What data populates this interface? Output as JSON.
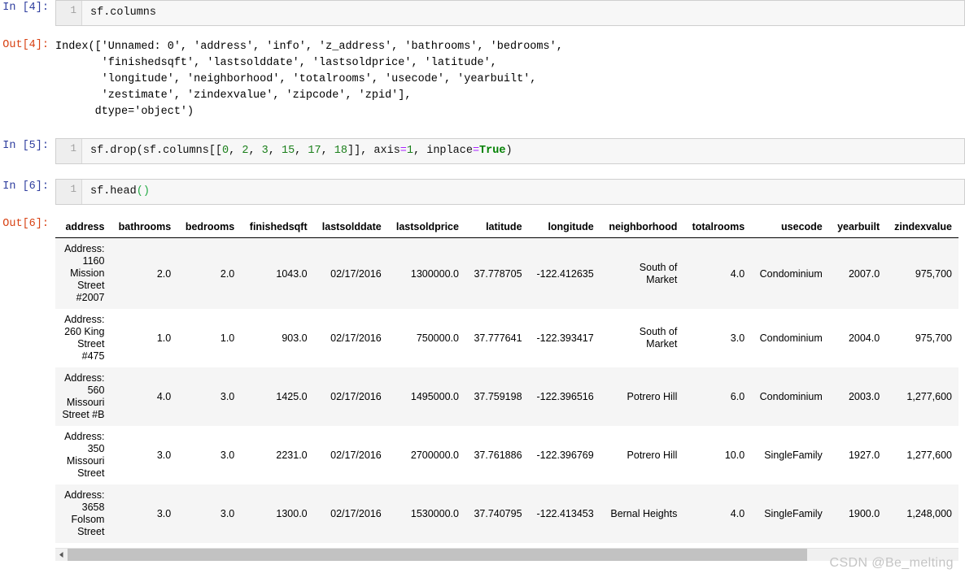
{
  "cells": [
    {
      "prompt_in": "In [4]:",
      "line_no": "1",
      "code": "sf.columns",
      "prompt_out": "Out[4]:",
      "output_text": "Index(['Unnamed: 0', 'address', 'info', 'z_address', 'bathrooms', 'bedrooms',\n       'finishedsqft', 'lastsolddate', 'lastsoldprice', 'latitude',\n       'longitude', 'neighborhood', 'totalrooms', 'usecode', 'yearbuilt',\n       'zestimate', 'zindexvalue', 'zipcode', 'zpid'],\n      dtype='object')"
    },
    {
      "prompt_in": "In [5]:",
      "line_no": "1",
      "code_parts": [
        {
          "text": "sf.drop(sf.columns[[",
          "type": "plain"
        },
        {
          "text": "0",
          "type": "num"
        },
        {
          "text": ", ",
          "type": "plain"
        },
        {
          "text": "2",
          "type": "num"
        },
        {
          "text": ", ",
          "type": "plain"
        },
        {
          "text": "3",
          "type": "num"
        },
        {
          "text": ", ",
          "type": "plain"
        },
        {
          "text": "15",
          "type": "num"
        },
        {
          "text": ", ",
          "type": "plain"
        },
        {
          "text": "17",
          "type": "num"
        },
        {
          "text": ", ",
          "type": "plain"
        },
        {
          "text": "18",
          "type": "num"
        },
        {
          "text": "]], axis",
          "type": "plain"
        },
        {
          "text": "=",
          "type": "op"
        },
        {
          "text": "1",
          "type": "num"
        },
        {
          "text": ", inplace",
          "type": "plain"
        },
        {
          "text": "=",
          "type": "op"
        },
        {
          "text": "True",
          "type": "kw"
        },
        {
          "text": ")",
          "type": "plain"
        }
      ]
    },
    {
      "prompt_in": "In [6]:",
      "line_no": "1",
      "code_head": "sf.head",
      "code_parens": "()",
      "prompt_out": "Out[6]:"
    }
  ],
  "dataframe": {
    "columns": [
      "address",
      "bathrooms",
      "bedrooms",
      "finishedsqft",
      "lastsolddate",
      "lastsoldprice",
      "latitude",
      "longitude",
      "neighborhood",
      "totalrooms",
      "usecode",
      "yearbuilt",
      "zindexvalue"
    ],
    "rows": [
      {
        "address": "Address: 1160 Mission Street #2007",
        "bathrooms": "2.0",
        "bedrooms": "2.0",
        "finishedsqft": "1043.0",
        "lastsolddate": "02/17/2016",
        "lastsoldprice": "1300000.0",
        "latitude": "37.778705",
        "longitude": "-122.412635",
        "neighborhood": "South of Market",
        "totalrooms": "4.0",
        "usecode": "Condominium",
        "yearbuilt": "2007.0",
        "zindexvalue": "975,700"
      },
      {
        "address": "Address: 260 King Street #475",
        "bathrooms": "1.0",
        "bedrooms": "1.0",
        "finishedsqft": "903.0",
        "lastsolddate": "02/17/2016",
        "lastsoldprice": "750000.0",
        "latitude": "37.777641",
        "longitude": "-122.393417",
        "neighborhood": "South of Market",
        "totalrooms": "3.0",
        "usecode": "Condominium",
        "yearbuilt": "2004.0",
        "zindexvalue": "975,700"
      },
      {
        "address": "Address: 560 Missouri Street #B",
        "bathrooms": "4.0",
        "bedrooms": "3.0",
        "finishedsqft": "1425.0",
        "lastsolddate": "02/17/2016",
        "lastsoldprice": "1495000.0",
        "latitude": "37.759198",
        "longitude": "-122.396516",
        "neighborhood": "Potrero Hill",
        "totalrooms": "6.0",
        "usecode": "Condominium",
        "yearbuilt": "2003.0",
        "zindexvalue": "1,277,600"
      },
      {
        "address": "Address: 350 Missouri Street",
        "bathrooms": "3.0",
        "bedrooms": "3.0",
        "finishedsqft": "2231.0",
        "lastsolddate": "02/17/2016",
        "lastsoldprice": "2700000.0",
        "latitude": "37.761886",
        "longitude": "-122.396769",
        "neighborhood": "Potrero Hill",
        "totalrooms": "10.0",
        "usecode": "SingleFamily",
        "yearbuilt": "1927.0",
        "zindexvalue": "1,277,600"
      },
      {
        "address": "Address: 3658 Folsom Street",
        "bathrooms": "3.0",
        "bedrooms": "3.0",
        "finishedsqft": "1300.0",
        "lastsolddate": "02/17/2016",
        "lastsoldprice": "1530000.0",
        "latitude": "37.740795",
        "longitude": "-122.413453",
        "neighborhood": "Bernal Heights",
        "totalrooms": "4.0",
        "usecode": "SingleFamily",
        "yearbuilt": "1900.0",
        "zindexvalue": "1,248,000"
      }
    ]
  },
  "watermark": "CSDN @Be_melting",
  "colors": {
    "prompt_in": "#303F9F",
    "prompt_out": "#D84315",
    "code_bg": "#f7f7f7",
    "row_alt_bg": "#f5f5f5",
    "scrollbar_thumb": "#c2c2c2"
  }
}
